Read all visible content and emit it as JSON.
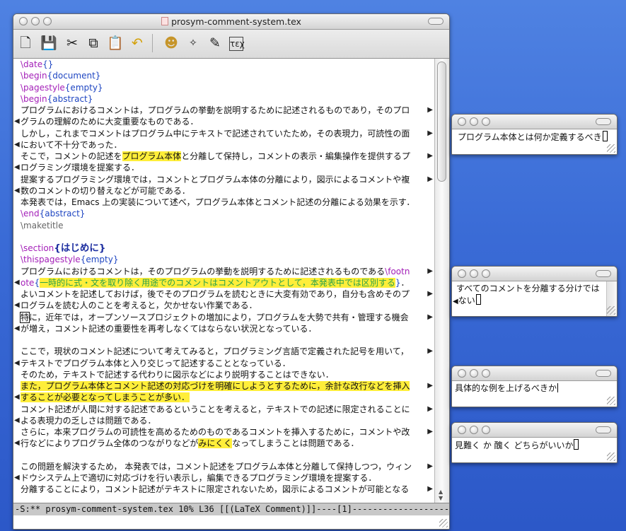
{
  "main_window": {
    "title": "prosym-comment-system.tex",
    "toolbar": [
      "new-file",
      "save",
      "cut",
      "copy",
      "paste",
      "undo",
      "latex",
      "dvi",
      "view",
      "tex-it"
    ],
    "lines": [
      {
        "parts": [
          [
            "cmd",
            "\\date"
          ],
          [
            "arg",
            "{}"
          ]
        ]
      },
      {
        "parts": [
          [
            "cmd",
            "\\begin"
          ],
          [
            "arg",
            "{document}"
          ]
        ]
      },
      {
        "parts": [
          [
            "cmd",
            "\\pagestyle"
          ],
          [
            "arg",
            "{empty}"
          ]
        ]
      },
      {
        "parts": [
          [
            "cmd",
            "\\begin"
          ],
          [
            "arg",
            "{abstract}"
          ]
        ]
      },
      {
        "parts": [
          [
            "t",
            "プログラムにおけるコメントは，プログラムの挙動を説明するために記述されるものであり，そのプロ"
          ]
        ],
        "r": true
      },
      {
        "parts": [
          [
            "t",
            "グラムの理解のために大変重要なものである．"
          ]
        ],
        "l": true
      },
      {
        "parts": [
          [
            "t",
            "しかし，これまでコメントはプログラム中にテキストで記述されていたため，その表現力，可読性の面"
          ]
        ],
        "r": true
      },
      {
        "parts": [
          [
            "t",
            "において不十分であった．"
          ]
        ],
        "l": true
      },
      {
        "parts": [
          [
            "t",
            "そこで，コメントの記述を"
          ],
          [
            "hl",
            "プログラム本体"
          ],
          [
            "t",
            "と分離して保持し，コメントの表示・編集操作を提供するプ"
          ]
        ],
        "r": true
      },
      {
        "parts": [
          [
            "t",
            "ログラミング環境を提案する．"
          ]
        ],
        "l": true
      },
      {
        "parts": [
          [
            "t",
            "提案するプログラミング環境では，コメントとプログラム本体の分離により，図示によるコメントや複"
          ]
        ],
        "r": true
      },
      {
        "parts": [
          [
            "t",
            "数のコメントの切り替えなどが可能である．"
          ]
        ],
        "l": true
      },
      {
        "parts": [
          [
            "t",
            "本発表では，Emacs 上の実装について述べ，プログラム本体とコメント記述の分離による効果を示す．"
          ]
        ]
      },
      {
        "parts": [
          [
            "cmd",
            "\\end"
          ],
          [
            "arg",
            "{abstract}"
          ]
        ]
      },
      {
        "parts": [
          [
            "mk",
            "\\maketitle"
          ]
        ]
      },
      {
        "parts": []
      },
      {
        "parts": [
          [
            "cmd",
            "\\section"
          ],
          [
            "sec",
            "{はじめに}"
          ]
        ]
      },
      {
        "parts": [
          [
            "cmd",
            "\\thispagestyle"
          ],
          [
            "arg",
            "{empty}"
          ]
        ]
      },
      {
        "parts": [
          [
            "t",
            "プログラムにおけるコメントは，そのプログラムの挙動を説明するために記述されるものである"
          ],
          [
            "cmd",
            "\\footn"
          ]
        ],
        "r": true
      },
      {
        "parts": [
          [
            "cmd",
            "ote"
          ],
          [
            "arg",
            "{"
          ],
          [
            "hlg",
            "一時的に式・文を取り除く用途でのコメントはコメントアウトとして，本発表中では区別する"
          ],
          [
            "arg",
            "}"
          ],
          [
            "t",
            "．"
          ]
        ],
        "l": true
      },
      {
        "parts": [
          [
            "t",
            "よいコメントを記述しておけば，後でそのプログラムを読むときに大変有効であり，自分も含めそのプ"
          ]
        ],
        "r": true
      },
      {
        "parts": [
          [
            "t",
            "ログラムを読む人のことを考えると，欠かせない作業である．"
          ]
        ],
        "l": true
      },
      {
        "parts": [
          [
            "box",
            "特"
          ],
          [
            "t",
            "に，近年では，オープンソースプロジェクトの増加により，プログラムを大勢で共有・管理する機会"
          ]
        ],
        "r": true
      },
      {
        "parts": [
          [
            "t",
            "が増え，コメント記述の重要性を再考しなくてはならない状況となっている．"
          ]
        ],
        "l": true
      },
      {
        "parts": []
      },
      {
        "parts": [
          [
            "t",
            "ここで，現状のコメント記述について考えてみると，プログラミング言語で定義された記号を用いて，"
          ]
        ],
        "r": true
      },
      {
        "parts": [
          [
            "t",
            "テキストでプログラム本体と入り交じって記述することとなっている．"
          ]
        ],
        "l": true
      },
      {
        "parts": [
          [
            "t",
            "そのため，テキストで記述する代わりに図示などにより説明することはできない．"
          ]
        ]
      },
      {
        "parts": [
          [
            "hl",
            "また，プログラム本体とコメント記述の対応づけを明確にしようとするために，余計な改行などを挿入"
          ]
        ],
        "r": true
      },
      {
        "parts": [
          [
            "hl",
            "することが必要となってしまうことが多い．"
          ]
        ],
        "l": true
      },
      {
        "parts": [
          [
            "t",
            "コメント記述が人間に対する記述であるということを考えると，テキストでの記述に限定されることに"
          ]
        ],
        "r": true
      },
      {
        "parts": [
          [
            "t",
            "よる表現力の乏しさは問題である．"
          ]
        ],
        "l": true
      },
      {
        "parts": [
          [
            "t",
            "さらに，本来プログラムの可読性を高めるためのものであるコメントを挿入するために，コメントや改"
          ]
        ],
        "r": true
      },
      {
        "parts": [
          [
            "t",
            "行などによりプログラム全体のつながりなどが"
          ],
          [
            "hl",
            "みにくく"
          ],
          [
            "t",
            "なってしまうことは問題である．"
          ]
        ],
        "l": true
      },
      {
        "parts": []
      },
      {
        "parts": [
          [
            "t",
            "この問題を解決するため， 本発表では，コメント記述をプログラム本体と分離して保持しつつ，ウィン"
          ]
        ],
        "r": true
      },
      {
        "parts": [
          [
            "t",
            "ドウシステム上で適切に対応づけを行い表示し，編集できるプログラミング環境を提案する．"
          ]
        ],
        "l": true
      },
      {
        "parts": [
          [
            "t",
            "分離することにより，コメント記述がテキストに限定されないため，図示によるコメントが可能となる"
          ]
        ],
        "r": true
      }
    ],
    "modeline": "-S:**  prosym-comment-system.tex    10% L36    [[(LaTeX Comment)]]----[1]-----------------------"
  },
  "comment_windows": [
    {
      "text": "プログラム本体とは何か定義するべき",
      "caret": "box"
    },
    {
      "text": "すべてのコメントを分離する分けでは",
      "text2": "ない",
      "caret": "box"
    },
    {
      "text": "具体的な例を上げるべきか",
      "caret": "bar"
    },
    {
      "text": "見難く か 醜く どちらがいいか",
      "caret": "box"
    }
  ]
}
